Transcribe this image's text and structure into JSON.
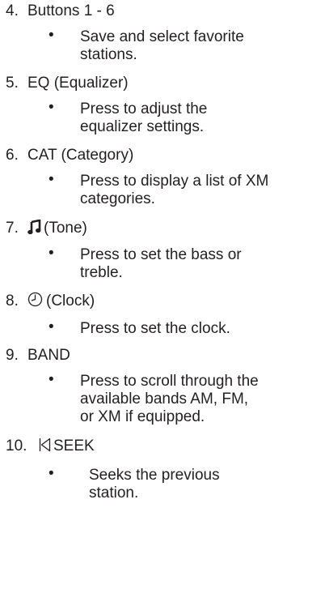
{
  "items": [
    {
      "number": "4.",
      "title": "Buttons 1 - 6",
      "description": "Save and select favorite\nstations."
    },
    {
      "number": "5.",
      "title": "EQ (Equalizer)",
      "description": "Press to adjust the\nequalizer settings."
    },
    {
      "number": "6.",
      "title": "CAT (Category)",
      "description": "Press to display a list of XM\ncategories."
    },
    {
      "number": "7.",
      "icon": "music-note-icon",
      "title": "(Tone)",
      "description": "Press to set the bass or\ntreble."
    },
    {
      "number": "8.",
      "icon": "clock-icon",
      "title": "(Clock)",
      "description": "Press to set the clock."
    },
    {
      "number": "9.",
      "title": "BAND",
      "description": "Press to scroll through the\navailable bands AM, FM,\nor XM if equipped."
    },
    {
      "number": "10.",
      "icon": "seek-back-icon",
      "title": "SEEK",
      "description": "Seeks the previous\nstation."
    }
  ],
  "bullet": "•"
}
